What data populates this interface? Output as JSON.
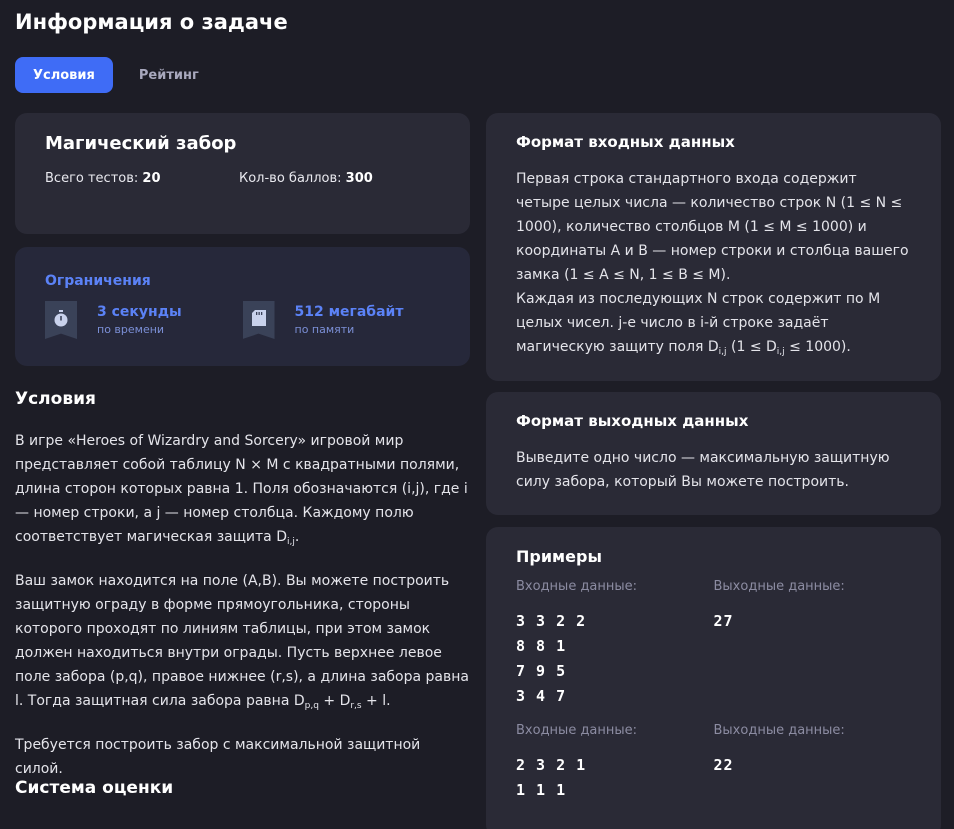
{
  "page": {
    "title": "Информация о задаче"
  },
  "tabs": [
    {
      "label": "Условия",
      "active": true
    },
    {
      "label": "Рейтинг",
      "active": false
    }
  ],
  "task": {
    "name": "Магический забор",
    "tests_label": "Всего тестов:",
    "tests_value": "20",
    "points_label": "Кол-во баллов:",
    "points_value": "300"
  },
  "limits": {
    "title": "Ограничения",
    "time": {
      "value": "3 секунды",
      "label": "по времени",
      "icon": "stopwatch-icon"
    },
    "memory": {
      "value": "512 мегабайт",
      "label": "по памяти",
      "icon": "memory-card-icon"
    }
  },
  "conditions": {
    "heading": "Условия",
    "p1_a": "В игре «Heroes of Wizardry and Sorcery» игровой мир представляет собой таблицу N × M с квадратными полями, длина сторон которых равна 1. Поля обозначаются (i,j), где i — номер строки, a j — номер столбца. Каждому полю соответствует магическая защита D",
    "p1_sub": "i,j",
    "p1_b": ".",
    "p2_a": "Ваш замок находится на поле (A,B). Вы можете построить защитную ограду в форме прямоугольника, стороны которого проходят по линиям таблицы, при этом замок должен находиться внутри ограды. Пусть верхнее левое поле забора (p,q), правое нижнее (r,s), а длина забора равна l. Тогда защитная сила забора равна D",
    "p2_sub1": "p,q",
    "p2_mid": " + D",
    "p2_sub2": "r,s",
    "p2_b": " + l.",
    "p3": "Требуется построить забор с максимальной защитной силой."
  },
  "scoring": {
    "heading": "Система оценки"
  },
  "input_format": {
    "heading": "Формат входных данных",
    "text_a": "Первая строка стандартного входа содержит четыре целых числа — количество строк N (1 ≤ N ≤ 1000), количество столбцов M (1 ≤ M ≤ 1000) и координаты A и B — номер строки и столбца вашего замка (1 ≤ A ≤ N, 1 ≤ B ≤ M).",
    "text_b": "Каждая из последующих N строк содержит по M целых чисел. j-е число в i-й строке задаёт магическую защиту поля D",
    "sub1": "i,j",
    "text_c": " (1 ≤ D",
    "sub2": "i,j",
    "text_d": " ≤ 1000)."
  },
  "output_format": {
    "heading": "Формат выходных данных",
    "text": "Выведите одно число — максимальную защитную силу забора, который Вы можете построить."
  },
  "examples": {
    "heading": "Примеры",
    "items": [
      {
        "input_label": "Входные данные:",
        "output_label": "Выходные данные:",
        "input": "3 3 2 2\n8 8 1\n7 9 5\n3 4 7",
        "output": "27"
      },
      {
        "input_label": "Входные данные:",
        "output_label": "Выходные данные:",
        "input": "2 3 2 1\n1 1 1",
        "output": "22"
      }
    ]
  }
}
